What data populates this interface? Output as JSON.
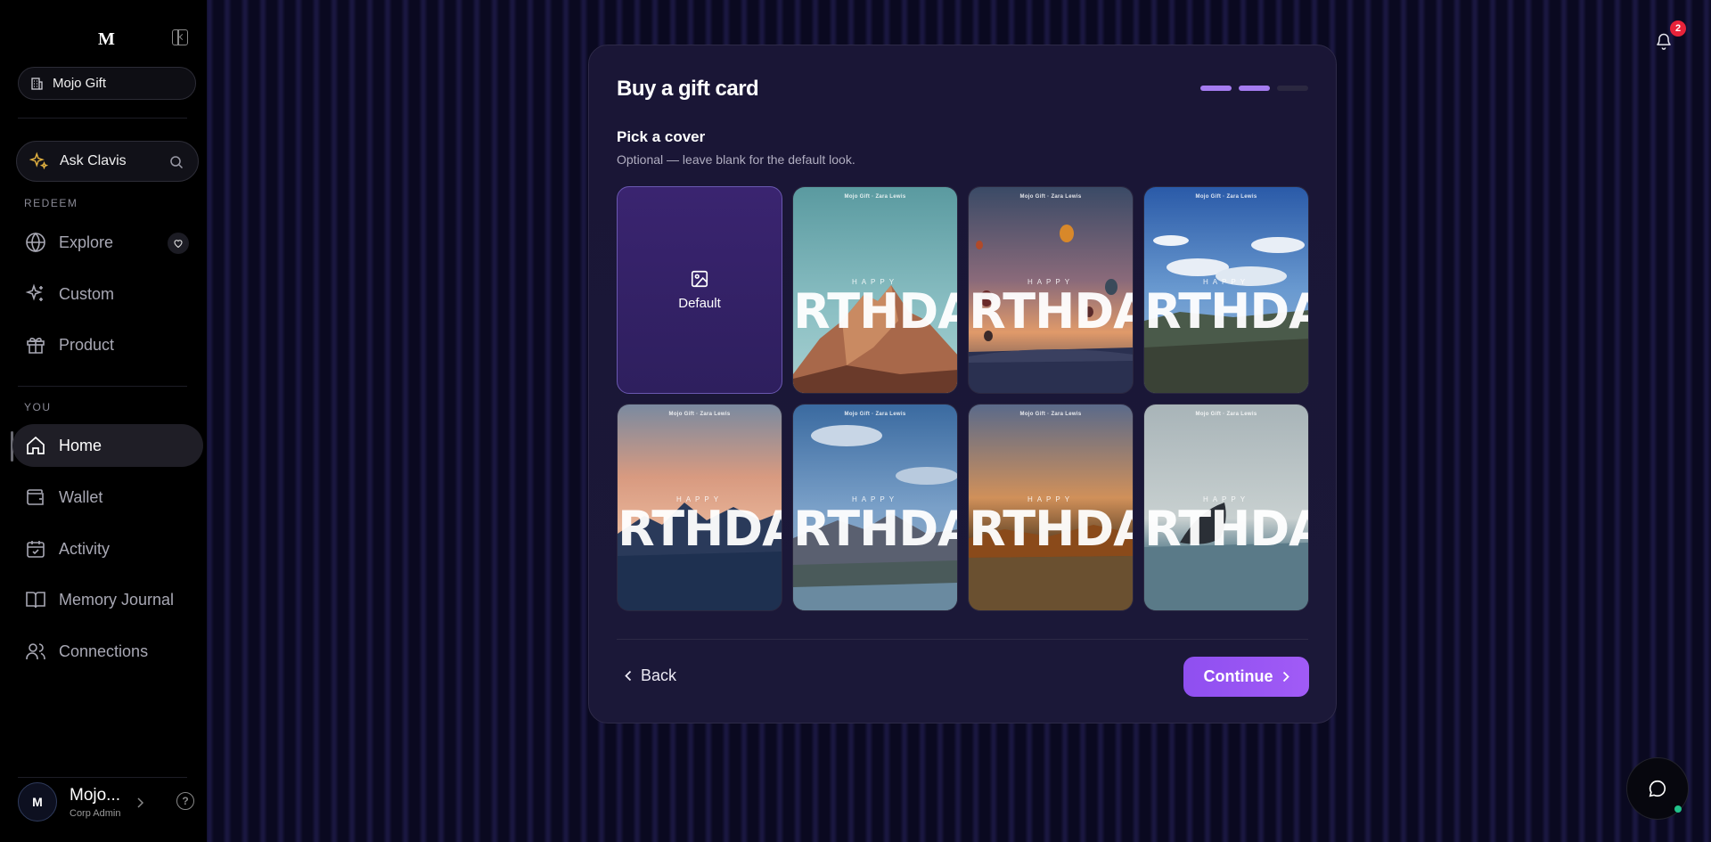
{
  "sidebar": {
    "logo": "M",
    "workspace": "Mojo Gift",
    "ask": "Ask Clavis",
    "redeem_label": "REDEEM",
    "redeem_items": [
      {
        "label": "Explore",
        "icon": "globe-icon"
      },
      {
        "label": "Custom",
        "icon": "sparkles-icon"
      },
      {
        "label": "Product",
        "icon": "gift-icon"
      }
    ],
    "you_label": "YOU",
    "you_items": [
      {
        "label": "Home",
        "icon": "home-icon",
        "active": true
      },
      {
        "label": "Wallet",
        "icon": "wallet-icon"
      },
      {
        "label": "Activity",
        "icon": "calendar-check-icon"
      },
      {
        "label": "Memory Journal",
        "icon": "book-icon"
      },
      {
        "label": "Connections",
        "icon": "users-icon"
      }
    ],
    "user": {
      "initial": "M",
      "name": "Mojo...",
      "role": "Corp Admin"
    }
  },
  "notifications": {
    "count": "2"
  },
  "card": {
    "title": "Buy a gift card",
    "steps_total": 3,
    "steps_done": 2,
    "section_title": "Pick a cover",
    "section_sub": "Optional — leave blank for the default look.",
    "default_label": "Default",
    "cover_brand": "Mojo Gift · Zara Lewis",
    "cover_happy": "HAPPY",
    "cover_big": "IRTHDA",
    "covers": [
      {
        "scene": "mountain-peak"
      },
      {
        "scene": "hot-air-balloons"
      },
      {
        "scene": "blue-sky-hills"
      },
      {
        "scene": "sunset-mountains"
      },
      {
        "scene": "lake-mountains"
      },
      {
        "scene": "autumn-lake"
      },
      {
        "scene": "whale-ocean"
      }
    ],
    "back_label": "Back",
    "continue_label": "Continue"
  },
  "colors": {
    "accent": "#9b57f5",
    "step_done": "#a57cf0",
    "badge": "#e8233a",
    "online": "#21c28a"
  }
}
